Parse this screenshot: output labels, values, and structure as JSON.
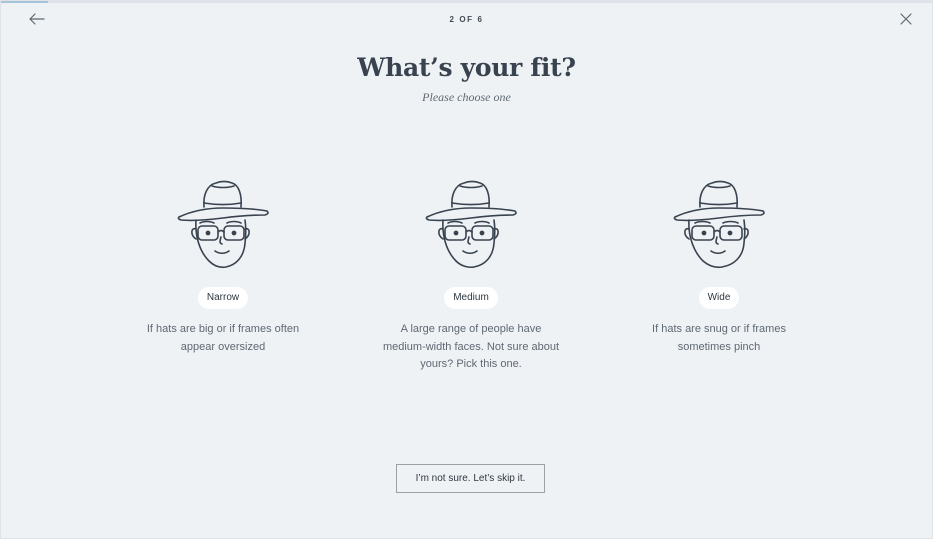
{
  "progress": {
    "fraction": 0.05
  },
  "header": {
    "step": "2 OF 6",
    "back_icon": "arrow-left-icon",
    "close_icon": "close-icon"
  },
  "main": {
    "title": "What’s your fit?",
    "subtitle": "Please choose one"
  },
  "options": [
    {
      "label": "Narrow",
      "description": "If hats are big or if frames often appear oversized",
      "icon": "face-with-hat-and-glasses-icon"
    },
    {
      "label": "Medium",
      "description": "A large range of people have medium-width faces. Not sure about yours? Pick this one.",
      "icon": "face-with-hat-and-glasses-icon"
    },
    {
      "label": "Wide",
      "description": "If hats are snug or if frames sometimes pinch",
      "icon": "face-with-hat-and-glasses-icon"
    }
  ],
  "skip_button": {
    "label": "I’m not sure. Let’s skip it."
  },
  "colors": {
    "background": "#eef2f5",
    "text": "#414b56",
    "progress": "#a7c5da",
    "pill": "#ffffff"
  }
}
